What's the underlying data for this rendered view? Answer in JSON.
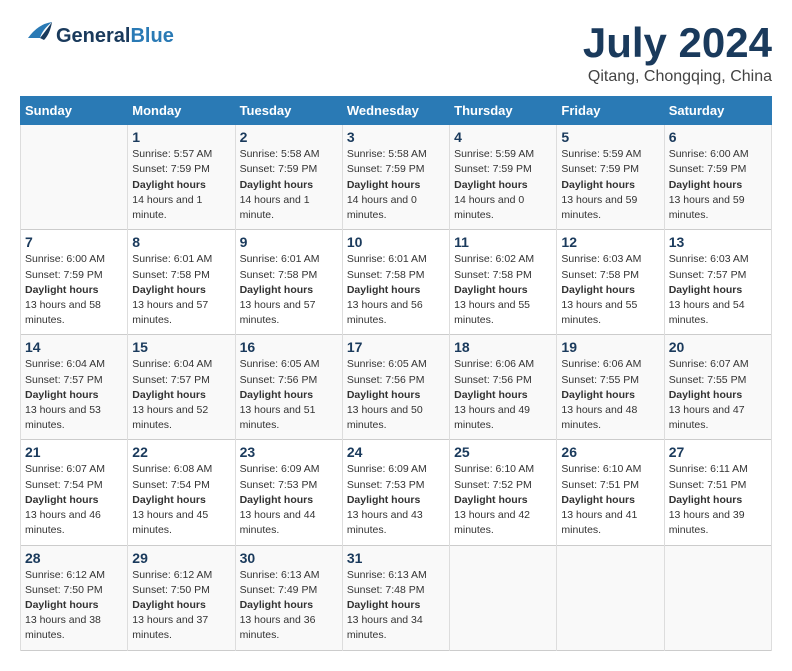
{
  "header": {
    "logo_general": "General",
    "logo_blue": "Blue",
    "month_title": "July 2024",
    "location": "Qitang, Chongqing, China"
  },
  "weekdays": [
    "Sunday",
    "Monday",
    "Tuesday",
    "Wednesday",
    "Thursday",
    "Friday",
    "Saturday"
  ],
  "weeks": [
    [
      {
        "day": "",
        "sunrise": "",
        "sunset": "",
        "daylight": ""
      },
      {
        "day": "1",
        "sunrise": "5:57 AM",
        "sunset": "7:59 PM",
        "daylight": "14 hours and 1 minute."
      },
      {
        "day": "2",
        "sunrise": "5:58 AM",
        "sunset": "7:59 PM",
        "daylight": "14 hours and 1 minute."
      },
      {
        "day": "3",
        "sunrise": "5:58 AM",
        "sunset": "7:59 PM",
        "daylight": "14 hours and 0 minutes."
      },
      {
        "day": "4",
        "sunrise": "5:59 AM",
        "sunset": "7:59 PM",
        "daylight": "14 hours and 0 minutes."
      },
      {
        "day": "5",
        "sunrise": "5:59 AM",
        "sunset": "7:59 PM",
        "daylight": "13 hours and 59 minutes."
      },
      {
        "day": "6",
        "sunrise": "6:00 AM",
        "sunset": "7:59 PM",
        "daylight": "13 hours and 59 minutes."
      }
    ],
    [
      {
        "day": "7",
        "sunrise": "6:00 AM",
        "sunset": "7:59 PM",
        "daylight": "13 hours and 58 minutes."
      },
      {
        "day": "8",
        "sunrise": "6:01 AM",
        "sunset": "7:58 PM",
        "daylight": "13 hours and 57 minutes."
      },
      {
        "day": "9",
        "sunrise": "6:01 AM",
        "sunset": "7:58 PM",
        "daylight": "13 hours and 57 minutes."
      },
      {
        "day": "10",
        "sunrise": "6:01 AM",
        "sunset": "7:58 PM",
        "daylight": "13 hours and 56 minutes."
      },
      {
        "day": "11",
        "sunrise": "6:02 AM",
        "sunset": "7:58 PM",
        "daylight": "13 hours and 55 minutes."
      },
      {
        "day": "12",
        "sunrise": "6:03 AM",
        "sunset": "7:58 PM",
        "daylight": "13 hours and 55 minutes."
      },
      {
        "day": "13",
        "sunrise": "6:03 AM",
        "sunset": "7:57 PM",
        "daylight": "13 hours and 54 minutes."
      }
    ],
    [
      {
        "day": "14",
        "sunrise": "6:04 AM",
        "sunset": "7:57 PM",
        "daylight": "13 hours and 53 minutes."
      },
      {
        "day": "15",
        "sunrise": "6:04 AM",
        "sunset": "7:57 PM",
        "daylight": "13 hours and 52 minutes."
      },
      {
        "day": "16",
        "sunrise": "6:05 AM",
        "sunset": "7:56 PM",
        "daylight": "13 hours and 51 minutes."
      },
      {
        "day": "17",
        "sunrise": "6:05 AM",
        "sunset": "7:56 PM",
        "daylight": "13 hours and 50 minutes."
      },
      {
        "day": "18",
        "sunrise": "6:06 AM",
        "sunset": "7:56 PM",
        "daylight": "13 hours and 49 minutes."
      },
      {
        "day": "19",
        "sunrise": "6:06 AM",
        "sunset": "7:55 PM",
        "daylight": "13 hours and 48 minutes."
      },
      {
        "day": "20",
        "sunrise": "6:07 AM",
        "sunset": "7:55 PM",
        "daylight": "13 hours and 47 minutes."
      }
    ],
    [
      {
        "day": "21",
        "sunrise": "6:07 AM",
        "sunset": "7:54 PM",
        "daylight": "13 hours and 46 minutes."
      },
      {
        "day": "22",
        "sunrise": "6:08 AM",
        "sunset": "7:54 PM",
        "daylight": "13 hours and 45 minutes."
      },
      {
        "day": "23",
        "sunrise": "6:09 AM",
        "sunset": "7:53 PM",
        "daylight": "13 hours and 44 minutes."
      },
      {
        "day": "24",
        "sunrise": "6:09 AM",
        "sunset": "7:53 PM",
        "daylight": "13 hours and 43 minutes."
      },
      {
        "day": "25",
        "sunrise": "6:10 AM",
        "sunset": "7:52 PM",
        "daylight": "13 hours and 42 minutes."
      },
      {
        "day": "26",
        "sunrise": "6:10 AM",
        "sunset": "7:51 PM",
        "daylight": "13 hours and 41 minutes."
      },
      {
        "day": "27",
        "sunrise": "6:11 AM",
        "sunset": "7:51 PM",
        "daylight": "13 hours and 39 minutes."
      }
    ],
    [
      {
        "day": "28",
        "sunrise": "6:12 AM",
        "sunset": "7:50 PM",
        "daylight": "13 hours and 38 minutes."
      },
      {
        "day": "29",
        "sunrise": "6:12 AM",
        "sunset": "7:50 PM",
        "daylight": "13 hours and 37 minutes."
      },
      {
        "day": "30",
        "sunrise": "6:13 AM",
        "sunset": "7:49 PM",
        "daylight": "13 hours and 36 minutes."
      },
      {
        "day": "31",
        "sunrise": "6:13 AM",
        "sunset": "7:48 PM",
        "daylight": "13 hours and 34 minutes."
      },
      {
        "day": "",
        "sunrise": "",
        "sunset": "",
        "daylight": ""
      },
      {
        "day": "",
        "sunrise": "",
        "sunset": "",
        "daylight": ""
      },
      {
        "day": "",
        "sunrise": "",
        "sunset": "",
        "daylight": ""
      }
    ]
  ]
}
